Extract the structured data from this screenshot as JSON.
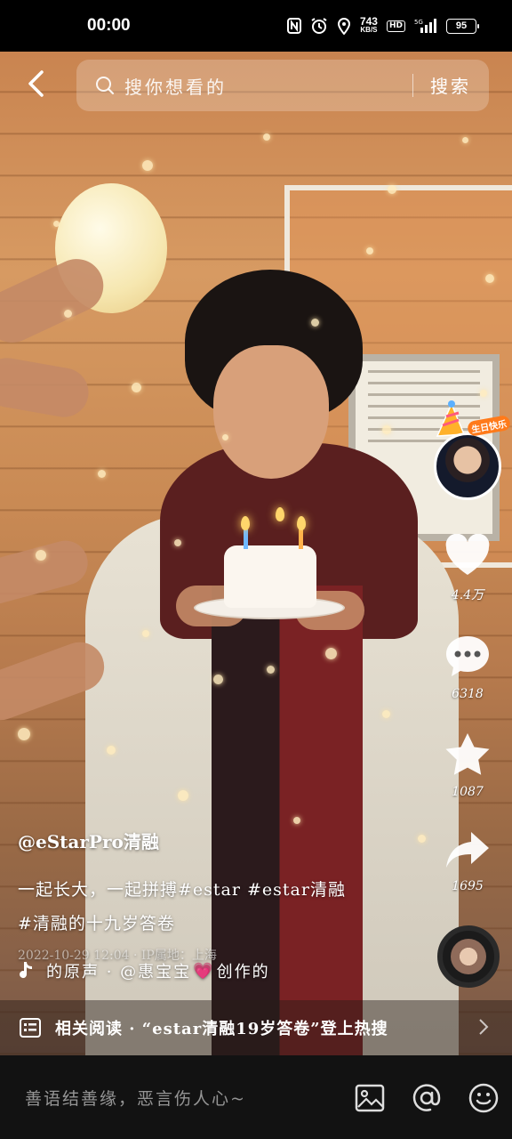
{
  "status_bar": {
    "time": "00:00",
    "net_speed_value": "743",
    "net_speed_unit": "KB/S",
    "hd_label": "HD",
    "signal_label": "5G",
    "battery": "95"
  },
  "search": {
    "placeholder": "搜你想看的",
    "button_label": "搜索"
  },
  "actions": {
    "likes": "4.4万",
    "comments": "6318",
    "favorites": "1087",
    "shares": "1695",
    "birthday_badge": "生日快乐"
  },
  "caption": {
    "author": "@eStarPro清融",
    "line1": "一起长大，一起拼搏#estar #estar清融",
    "line2": "#清融的十九岁答卷",
    "meta": "2022-10-29 12:04 · IP属地：上海"
  },
  "music": {
    "prefix": "的原声 · @惠宝宝",
    "heart": "💗",
    "suffix": "创作的"
  },
  "related": {
    "text": "相关阅读 · “estar清融19岁答卷”登上热搜"
  },
  "comment_bar": {
    "placeholder": "善语结善缘，恶言伤人心~"
  },
  "icons": {
    "back": "chevron-left-icon",
    "search": "search-icon",
    "like": "heart-icon",
    "comment": "comment-bubble-icon",
    "favorite": "star-icon",
    "share": "share-arrow-icon",
    "image": "image-icon",
    "mention": "at-icon",
    "emoji": "emoji-icon"
  }
}
